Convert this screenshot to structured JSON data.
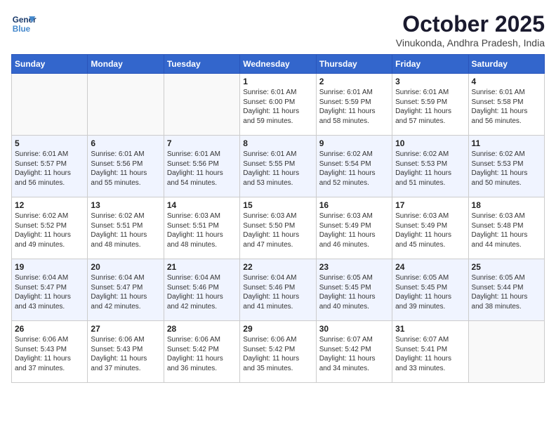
{
  "header": {
    "logo_line1": "General",
    "logo_line2": "Blue",
    "month": "October 2025",
    "location": "Vinukonda, Andhra Pradesh, India"
  },
  "days_of_week": [
    "Sunday",
    "Monday",
    "Tuesday",
    "Wednesday",
    "Thursday",
    "Friday",
    "Saturday"
  ],
  "weeks": [
    [
      {
        "day": "",
        "info": ""
      },
      {
        "day": "",
        "info": ""
      },
      {
        "day": "",
        "info": ""
      },
      {
        "day": "1",
        "info": "Sunrise: 6:01 AM\nSunset: 6:00 PM\nDaylight: 11 hours\nand 59 minutes."
      },
      {
        "day": "2",
        "info": "Sunrise: 6:01 AM\nSunset: 5:59 PM\nDaylight: 11 hours\nand 58 minutes."
      },
      {
        "day": "3",
        "info": "Sunrise: 6:01 AM\nSunset: 5:59 PM\nDaylight: 11 hours\nand 57 minutes."
      },
      {
        "day": "4",
        "info": "Sunrise: 6:01 AM\nSunset: 5:58 PM\nDaylight: 11 hours\nand 56 minutes."
      }
    ],
    [
      {
        "day": "5",
        "info": "Sunrise: 6:01 AM\nSunset: 5:57 PM\nDaylight: 11 hours\nand 56 minutes."
      },
      {
        "day": "6",
        "info": "Sunrise: 6:01 AM\nSunset: 5:56 PM\nDaylight: 11 hours\nand 55 minutes."
      },
      {
        "day": "7",
        "info": "Sunrise: 6:01 AM\nSunset: 5:56 PM\nDaylight: 11 hours\nand 54 minutes."
      },
      {
        "day": "8",
        "info": "Sunrise: 6:01 AM\nSunset: 5:55 PM\nDaylight: 11 hours\nand 53 minutes."
      },
      {
        "day": "9",
        "info": "Sunrise: 6:02 AM\nSunset: 5:54 PM\nDaylight: 11 hours\nand 52 minutes."
      },
      {
        "day": "10",
        "info": "Sunrise: 6:02 AM\nSunset: 5:53 PM\nDaylight: 11 hours\nand 51 minutes."
      },
      {
        "day": "11",
        "info": "Sunrise: 6:02 AM\nSunset: 5:53 PM\nDaylight: 11 hours\nand 50 minutes."
      }
    ],
    [
      {
        "day": "12",
        "info": "Sunrise: 6:02 AM\nSunset: 5:52 PM\nDaylight: 11 hours\nand 49 minutes."
      },
      {
        "day": "13",
        "info": "Sunrise: 6:02 AM\nSunset: 5:51 PM\nDaylight: 11 hours\nand 48 minutes."
      },
      {
        "day": "14",
        "info": "Sunrise: 6:03 AM\nSunset: 5:51 PM\nDaylight: 11 hours\nand 48 minutes."
      },
      {
        "day": "15",
        "info": "Sunrise: 6:03 AM\nSunset: 5:50 PM\nDaylight: 11 hours\nand 47 minutes."
      },
      {
        "day": "16",
        "info": "Sunrise: 6:03 AM\nSunset: 5:49 PM\nDaylight: 11 hours\nand 46 minutes."
      },
      {
        "day": "17",
        "info": "Sunrise: 6:03 AM\nSunset: 5:49 PM\nDaylight: 11 hours\nand 45 minutes."
      },
      {
        "day": "18",
        "info": "Sunrise: 6:03 AM\nSunset: 5:48 PM\nDaylight: 11 hours\nand 44 minutes."
      }
    ],
    [
      {
        "day": "19",
        "info": "Sunrise: 6:04 AM\nSunset: 5:47 PM\nDaylight: 11 hours\nand 43 minutes."
      },
      {
        "day": "20",
        "info": "Sunrise: 6:04 AM\nSunset: 5:47 PM\nDaylight: 11 hours\nand 42 minutes."
      },
      {
        "day": "21",
        "info": "Sunrise: 6:04 AM\nSunset: 5:46 PM\nDaylight: 11 hours\nand 42 minutes."
      },
      {
        "day": "22",
        "info": "Sunrise: 6:04 AM\nSunset: 5:46 PM\nDaylight: 11 hours\nand 41 minutes."
      },
      {
        "day": "23",
        "info": "Sunrise: 6:05 AM\nSunset: 5:45 PM\nDaylight: 11 hours\nand 40 minutes."
      },
      {
        "day": "24",
        "info": "Sunrise: 6:05 AM\nSunset: 5:45 PM\nDaylight: 11 hours\nand 39 minutes."
      },
      {
        "day": "25",
        "info": "Sunrise: 6:05 AM\nSunset: 5:44 PM\nDaylight: 11 hours\nand 38 minutes."
      }
    ],
    [
      {
        "day": "26",
        "info": "Sunrise: 6:06 AM\nSunset: 5:43 PM\nDaylight: 11 hours\nand 37 minutes."
      },
      {
        "day": "27",
        "info": "Sunrise: 6:06 AM\nSunset: 5:43 PM\nDaylight: 11 hours\nand 37 minutes."
      },
      {
        "day": "28",
        "info": "Sunrise: 6:06 AM\nSunset: 5:42 PM\nDaylight: 11 hours\nand 36 minutes."
      },
      {
        "day": "29",
        "info": "Sunrise: 6:06 AM\nSunset: 5:42 PM\nDaylight: 11 hours\nand 35 minutes."
      },
      {
        "day": "30",
        "info": "Sunrise: 6:07 AM\nSunset: 5:42 PM\nDaylight: 11 hours\nand 34 minutes."
      },
      {
        "day": "31",
        "info": "Sunrise: 6:07 AM\nSunset: 5:41 PM\nDaylight: 11 hours\nand 33 minutes."
      },
      {
        "day": "",
        "info": ""
      }
    ]
  ]
}
